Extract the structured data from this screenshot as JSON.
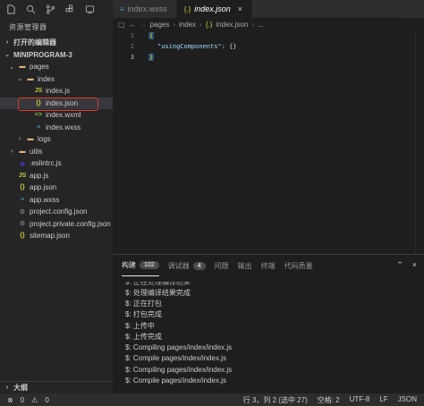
{
  "activity_icons": [
    "files-icon",
    "search-icon",
    "source-control-icon",
    "extensions-icon",
    "debug-icon"
  ],
  "tabs": [
    {
      "label": "index.wxss",
      "icon": "css-file-icon",
      "active": false
    },
    {
      "label": "index.json",
      "icon": "{.}",
      "active": true
    }
  ],
  "sidebar": {
    "title": "资源管理器",
    "open_editors": "打开的编辑器",
    "project": "MINIPROGRAM-3",
    "tree": [
      {
        "label": "pages",
        "indent": 1,
        "kind": "folder-open"
      },
      {
        "label": "index",
        "indent": 2,
        "kind": "folder-open"
      },
      {
        "label": "index.js",
        "indent": 3,
        "kind": "js"
      },
      {
        "label": "index.json",
        "indent": 3,
        "kind": "json",
        "selected": true
      },
      {
        "label": "index.wxml",
        "indent": 3,
        "kind": "wxml"
      },
      {
        "label": "index.wxss",
        "indent": 3,
        "kind": "wxss"
      },
      {
        "label": "logs",
        "indent": 2,
        "kind": "folder"
      },
      {
        "label": "utils",
        "indent": 1,
        "kind": "folder"
      },
      {
        "label": ".eslintrc.js",
        "indent": 1,
        "kind": "eslint"
      },
      {
        "label": "app.js",
        "indent": 1,
        "kind": "js"
      },
      {
        "label": "app.json",
        "indent": 1,
        "kind": "json"
      },
      {
        "label": "app.wxss",
        "indent": 1,
        "kind": "wxss"
      },
      {
        "label": "project.config.json",
        "indent": 1,
        "kind": "config"
      },
      {
        "label": "project.private.config.json",
        "indent": 1,
        "kind": "config"
      },
      {
        "label": "sitemap.json",
        "indent": 1,
        "kind": "json"
      }
    ],
    "outline": "大纲"
  },
  "breadcrumb": [
    "pages",
    "index",
    "index.json",
    "..."
  ],
  "editor": {
    "lines": [
      {
        "n": "1",
        "text": "{"
      },
      {
        "n": "2",
        "key": "\"usingComponents\"",
        "value": ": {}"
      },
      {
        "n": "3",
        "text": "}"
      }
    ]
  },
  "panel": {
    "tabs": [
      {
        "label": "构建",
        "badge": "102",
        "active": true
      },
      {
        "label": "调试器",
        "badge": "4",
        "active": false
      },
      {
        "label": "问题",
        "active": false
      },
      {
        "label": "输出",
        "active": false
      },
      {
        "label": "终端",
        "active": false
      },
      {
        "label": "代码质量",
        "active": false
      }
    ],
    "terminal_lines": [
      "$: 正在处理编译结果",
      "$: 处理编译结果完成",
      "$: 正在打包",
      "$: 打包完成",
      "$: 上传中",
      "$: 上传完成",
      "$: Compiling pages/index/index.js",
      "$: Compile pages/index/index.js",
      "$: Compiling pages/index/index.js",
      "$: Compile pages/index/index.js"
    ]
  },
  "status": {
    "errors": "0",
    "warnings": "0",
    "position": "行 3，列 2 (选中 27)",
    "spaces": "空格: 2",
    "encoding": "UTF-8",
    "eol": "LF",
    "language": "JSON"
  },
  "colors": {
    "accent_selection": "#e23c2b",
    "bg": "#1e1e1e",
    "sidebar": "#252526"
  }
}
